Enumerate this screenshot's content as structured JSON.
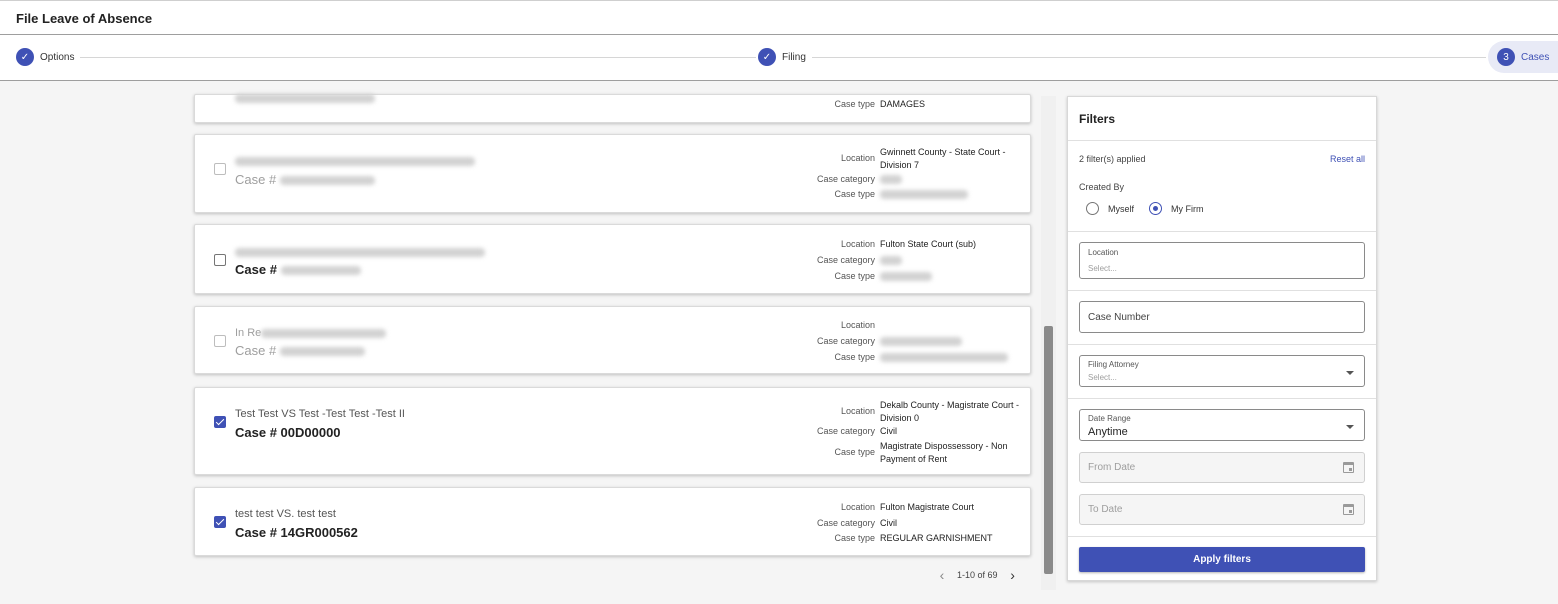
{
  "header": {
    "title": "File Leave of Absence"
  },
  "stepper": {
    "steps": [
      {
        "label": "Options",
        "marker": "✓",
        "state": "complete"
      },
      {
        "label": "Filing",
        "marker": "✓",
        "state": "complete"
      },
      {
        "label": "Cases",
        "marker": "3",
        "state": "active"
      }
    ]
  },
  "labels": {
    "location": "Location",
    "case_category": "Case category",
    "case_type": "Case type"
  },
  "cases": [
    {
      "state": "partial",
      "case_type": "DAMAGES"
    },
    {
      "state": "disabled",
      "case_prefix": "Case #",
      "location": "Gwinnett County - State Court - Division 7"
    },
    {
      "state": "enabled",
      "case_prefix": "Case #",
      "location": "Fulton State Court (sub)"
    },
    {
      "state": "disabled",
      "name_prefix": "In Re",
      "case_prefix": "Case #",
      "location": ""
    },
    {
      "state": "checked",
      "name": "Test Test VS Test -Test Test -Test II",
      "case_number": "Case # 00D00000",
      "location": "Dekalb County - Magistrate Court - Division 0",
      "case_category": "Civil",
      "case_type": "Magistrate Dispossessory - Non Payment of Rent"
    },
    {
      "state": "checked",
      "name": "test test VS. test test",
      "case_number": "Case # 14GR000562",
      "location": "Fulton Magistrate Court",
      "case_category": "Civil",
      "case_type": "REGULAR GARNISHMENT"
    }
  ],
  "pagination": {
    "range": "1-10 of 69",
    "prev_icon": "chevron-left-icon",
    "next_icon": "chevron-right-icon"
  },
  "filters": {
    "title": "Filters",
    "applied": "2 filter(s) applied",
    "reset": "Reset all",
    "created_by": {
      "label": "Created By",
      "options": [
        "Myself",
        "My Firm"
      ],
      "selected": "My Firm"
    },
    "location": {
      "label": "Location",
      "placeholder": "Select..."
    },
    "case_number": {
      "placeholder": "Case Number"
    },
    "filing_attorney": {
      "label": "Filing Attorney",
      "placeholder": "Select..."
    },
    "date_range": {
      "label": "Date Range",
      "value": "Anytime"
    },
    "from_date": {
      "placeholder": "From Date"
    },
    "to_date": {
      "placeholder": "To Date"
    },
    "apply": "Apply filters"
  },
  "colors": {
    "accent": "#3f51b5",
    "background": "#f5f5f5",
    "active_step_bg": "#e8eaf6"
  }
}
